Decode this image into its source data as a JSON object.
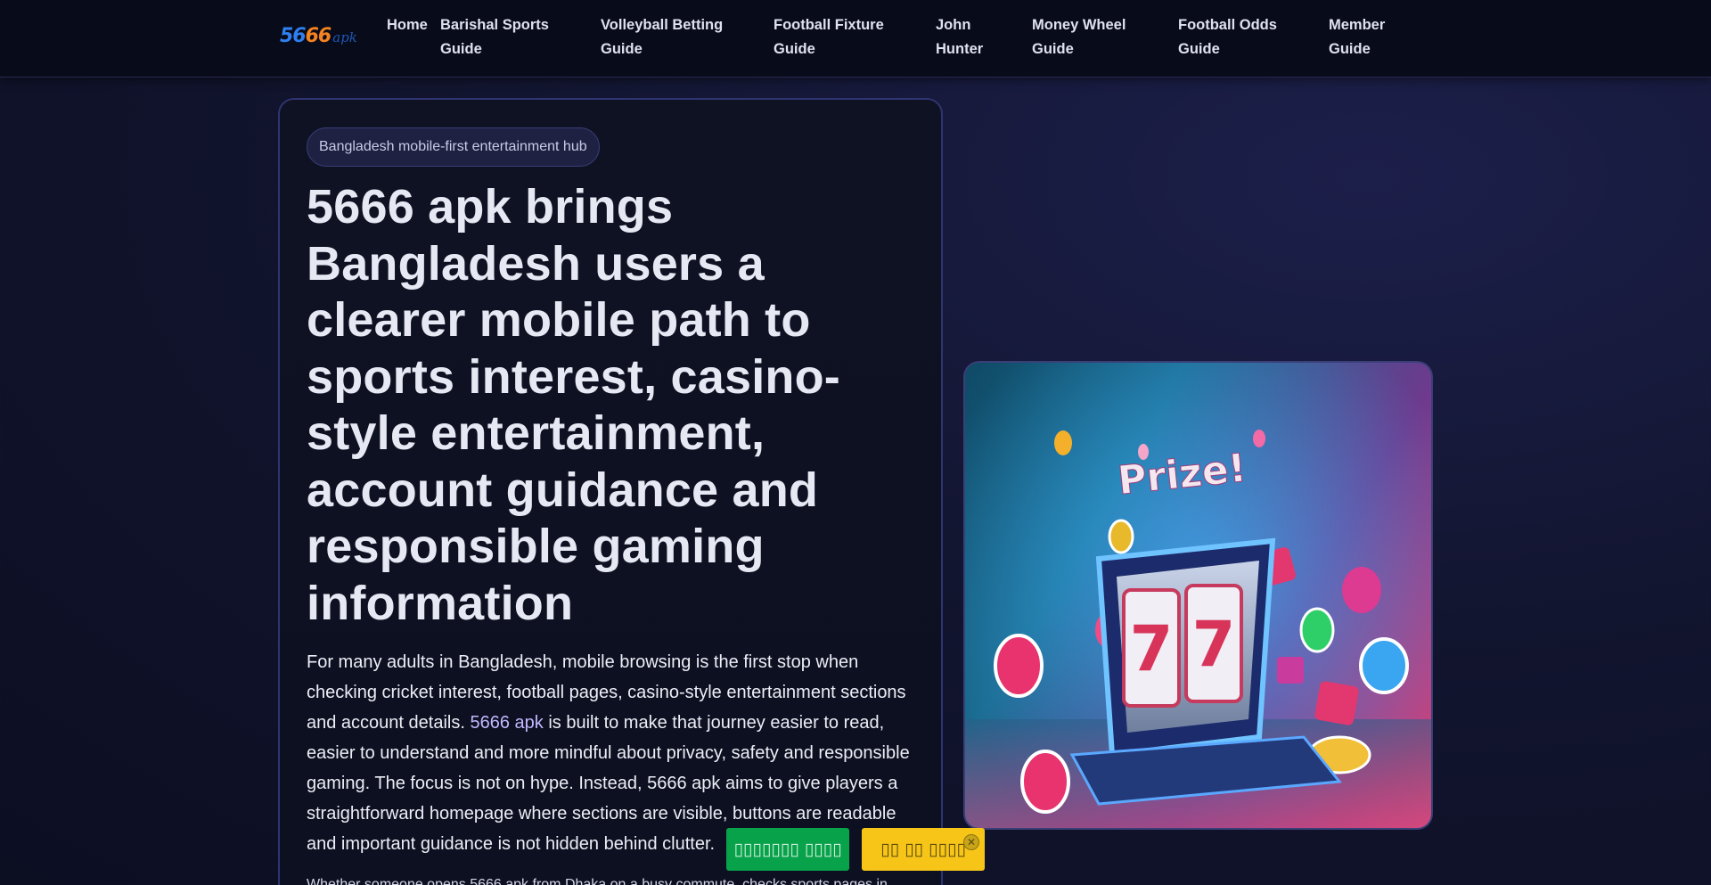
{
  "header": {
    "logo": {
      "number_part1": "56",
      "number_part2": "66",
      "suffix": "apk"
    },
    "nav": [
      {
        "label": "Home"
      },
      {
        "label": "Barishal Sports Guide"
      },
      {
        "label": "Volleyball Betting Guide"
      },
      {
        "label": "Football Fixture Guide"
      },
      {
        "label": "John Hunter"
      },
      {
        "label": "Money Wheel Guide"
      },
      {
        "label": "Football Odds Guide"
      },
      {
        "label": "Member Guide"
      }
    ]
  },
  "hero": {
    "badge": "Bangladesh mobile-first entertainment hub",
    "title": "5666 apk brings Bangladesh users a clearer mobile path to sports interest, casino-style entertainment, account guidance and responsible gaming information",
    "body_before_link": "For many adults in Bangladesh, mobile browsing is the first stop when checking cricket interest, football pages, casino-style entertainment sections and account details. ",
    "body_link": "5666 apk",
    "body_after_link": " is built to make that journey easier to read, easier to understand and more mindful about privacy, safety and responsible gaming. The focus is not on hype. Instead, 5666 apk aims to give players a straightforward homepage where sections are visible, buttons are readable and important guidance is not hidden behind clutter.",
    "sub_text": "Whether someone opens 5666 apk from Dhaka on a busy commute, checks sports pages in"
  },
  "image": {
    "sign_text": "Prize!",
    "reel_symbol": "7",
    "icon": "slot-machine-illustration"
  },
  "floating": {
    "green_label": "▯▯▯▯▯▯▯ ▯▯▯▯",
    "yellow_label": "▯▯ ▯▯ ▯▯▯▯",
    "close_label": "✕"
  },
  "colors": {
    "accent_link": "#c3b8ff",
    "green_button": "#08a24a",
    "yellow_button": "#f7c518",
    "card_border": "#2f3470"
  }
}
